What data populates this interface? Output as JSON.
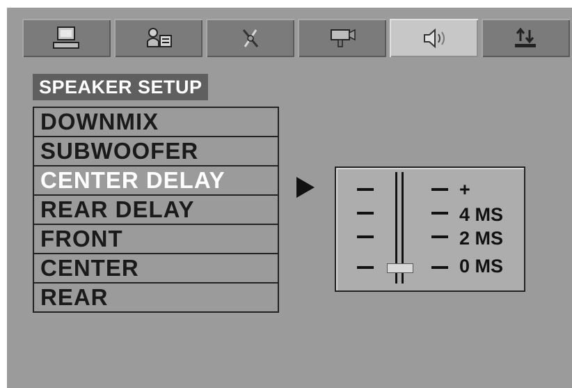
{
  "tabs": [
    {
      "icon": "computer-icon",
      "active": false
    },
    {
      "icon": "language-icon",
      "active": false
    },
    {
      "icon": "settings-icon",
      "active": false
    },
    {
      "icon": "video-icon",
      "active": false
    },
    {
      "icon": "speaker-icon",
      "active": true
    },
    {
      "icon": "exit-icon",
      "active": false
    }
  ],
  "menu": {
    "title": "SPEAKER SETUP",
    "items": [
      "DOWNMIX",
      "SUBWOOFER",
      "CENTER DELAY",
      "REAR DELAY",
      "FRONT",
      "CENTER",
      "REAR"
    ],
    "selected_index": 2
  },
  "slider": {
    "labels": [
      "+",
      "4 MS",
      "2 MS",
      "0 MS"
    ],
    "current_value": "0 MS"
  },
  "colors": {
    "screen_bg": "#9b9b9b",
    "active_tab": "#c7c7c7",
    "title_bg": "#5f5f5f"
  }
}
